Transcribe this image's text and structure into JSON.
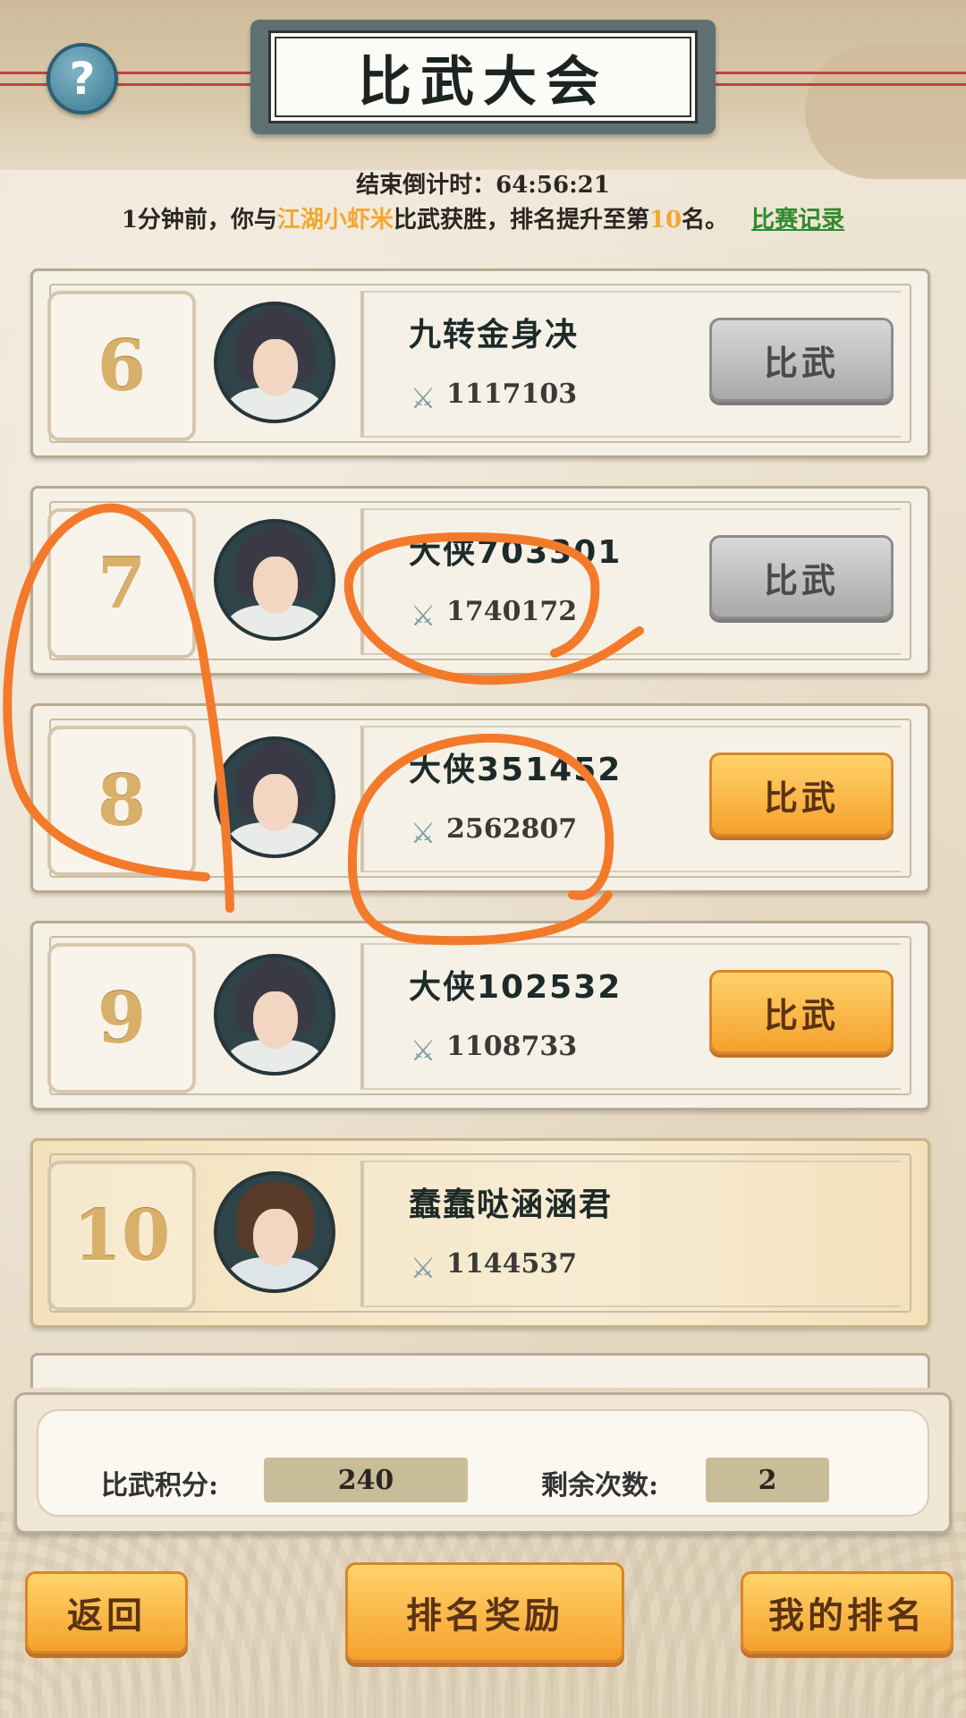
{
  "header": {
    "title": "比武大会",
    "help_symbol": "?"
  },
  "countdown": "结束倒计时：64:56:21",
  "notice": {
    "prefix": "1分钟前，你与",
    "opponent": "江湖小虾米",
    "middle": "比武获胜，排名提升至第",
    "rank": "10",
    "suffix": "名。",
    "record_link": "比赛记录"
  },
  "ranks": [
    {
      "rank": "6",
      "name": "九转金身决",
      "power": "1117103",
      "button": "比武",
      "button_state": "disabled"
    },
    {
      "rank": "7",
      "name": "大侠703301",
      "power": "1740172",
      "button": "比武",
      "button_state": "disabled"
    },
    {
      "rank": "8",
      "name": "大侠351452",
      "power": "2562807",
      "button": "比武",
      "button_state": "enabled"
    },
    {
      "rank": "9",
      "name": "大侠102532",
      "power": "1108733",
      "button": "比武",
      "button_state": "enabled"
    },
    {
      "rank": "10",
      "name": "蠢蠢哒涵涵君",
      "power": "1144537",
      "button": "",
      "button_state": "self"
    }
  ],
  "stats": {
    "score_label": "比武积分:",
    "score_value": "240",
    "remaining_label": "剩余次数:",
    "remaining_value": "2"
  },
  "buttons": {
    "back": "返回",
    "rank_rewards": "排名奖励",
    "my_rank": "我的排名"
  },
  "icons": {
    "help": "help-icon",
    "power": "crossed-swords-icon"
  },
  "colors": {
    "highlight": "#f0a830",
    "link": "#2f8a2c",
    "annotation": "#f47a2b",
    "button_orange": "#f5a12c",
    "button_gray": "#a9a9a9"
  }
}
